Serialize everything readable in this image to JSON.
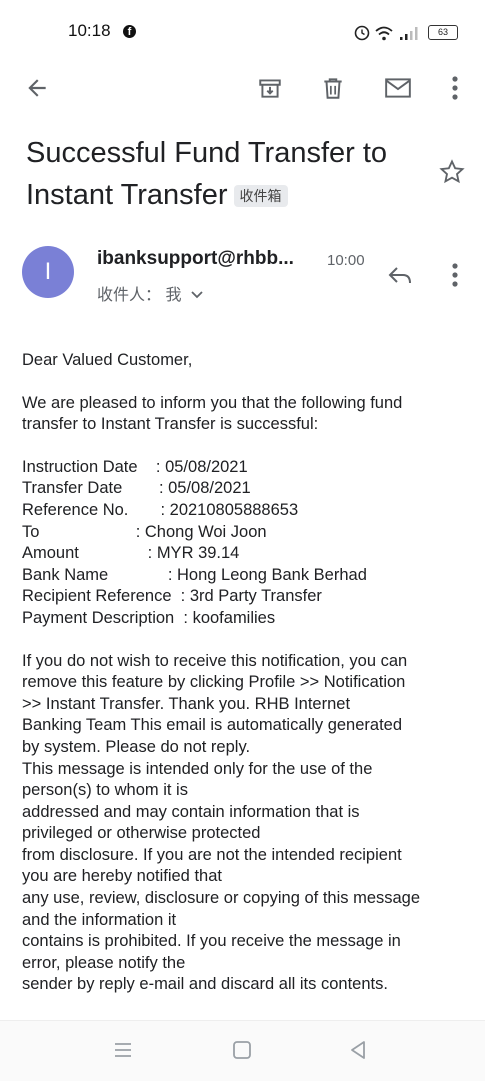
{
  "status_bar": {
    "time": "10:18",
    "fb_glyph": "f",
    "battery": "63",
    "icons": [
      "facebook-icon",
      "alarm-icon",
      "wifi-icon",
      "signal-icon",
      "battery-icon"
    ]
  },
  "toolbar": {
    "icons": [
      "back-arrow-icon",
      "archive-icon",
      "delete-icon",
      "mail-icon",
      "more-vert-icon"
    ]
  },
  "email": {
    "subject_line1": "Successful Fund Transfer to",
    "subject_line2": "Instant Transfer",
    "label": "收件箱",
    "sender": "ibanksupport@rhbb...",
    "time": "10:00",
    "to_line": "收件人： 我",
    "avatar_letter": "I",
    "avatar_color": "#7a80d6"
  },
  "body": {
    "greeting": "Dear Valued Customer,",
    "intro_1": "We are pleased to inform you that the following fund",
    "intro_2": "transfer to Instant Transfer is successful:",
    "details": [
      {
        "label": "Instruction Date",
        "sep": "    : ",
        "value": "05/08/2021"
      },
      {
        "label": "Transfer Date",
        "sep": "        : ",
        "value": "05/08/2021"
      },
      {
        "label": "Reference No.",
        "sep": "       : ",
        "value": "20210805888653"
      },
      {
        "label": "To",
        "sep": "                     : ",
        "value": "Chong Woi Joon"
      },
      {
        "label": "Amount",
        "sep": "               : ",
        "value": "MYR 39.14"
      },
      {
        "label": "Bank Name",
        "sep": "             : ",
        "value": "Hong Leong Bank Berhad"
      },
      {
        "label": "Recipient Reference",
        "sep": "  : ",
        "value": "3rd Party Transfer"
      },
      {
        "label": "Payment Description",
        "sep": "  : ",
        "value": "koofamilies"
      }
    ],
    "footer_lines": [
      "If you do not wish to receive this notification, you can",
      "remove this feature by clicking Profile >>  Notification",
      ">> Instant Transfer.   Thank you.   RHB Internet",
      "Banking Team   This email is automatically generated",
      "by system. Please do not reply.",
      "This message is intended only for the use of the",
      "person(s) to whom it is",
      "addressed and may contain information that is",
      "privileged or otherwise protected",
      "from disclosure. If you are not the intended recipient",
      "you are hereby notified that",
      "any use, review, disclosure or copying of this message",
      "and the information it",
      "contains is prohibited. If you receive the message in",
      "error, please notify the",
      "sender by reply e-mail and discard all its contents."
    ]
  },
  "nav_bar": {
    "icons": [
      "recent-apps-icon",
      "home-icon",
      "back-icon"
    ]
  }
}
